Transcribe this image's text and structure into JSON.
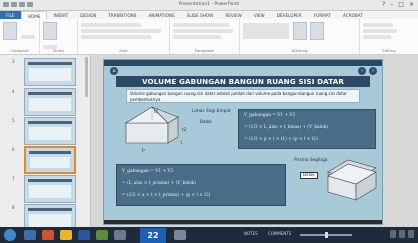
{
  "window": {
    "title": "Presentation1 - PowerPoint"
  },
  "ribbon": {
    "tabs": [
      "FILE",
      "HOME",
      "INSERT",
      "DESIGN",
      "TRANSITIONS",
      "ANIMATIONS",
      "SLIDE SHOW",
      "REVIEW",
      "VIEW",
      "DEVELOPER",
      "FORMAT",
      "ACROBAT"
    ],
    "groups": [
      "Clipboard",
      "Slides",
      "Font",
      "Paragraph",
      "Drawing",
      "Editing"
    ]
  },
  "slides_pane": {
    "numbers": [
      "3",
      "4",
      "5",
      "6",
      "7",
      "8"
    ]
  },
  "slide": {
    "title": "VOLUME GABUNGAN BANGUN RUANG SISI DATAR",
    "intro": "Volume gabungan bangun ruang sisi datar adalah jumlah dari volume pada bangun-bangun ruang sisi datar pembentuknya.",
    "shape1_name": "Limas Segi Empat",
    "shape1_sub": "Balok",
    "shape2_name": "Prisma Segitiga",
    "shape2_sub": "Balok",
    "formula1": {
      "lines": [
        "V_gabungan = V1 + V2",
        "= (1/3 × L_alas × t_limas) + (V_balok)",
        "= (1/3 × p × l × t1) + (p × l × t2)"
      ]
    },
    "formula2": {
      "lines": [
        "V_gabungan = V1 + V2",
        "= (L_alas × t_prisma) + (V_balok)",
        "= (1/2 × a × t × t_prisma) + (p × l × t2)"
      ]
    },
    "labels": {
      "t1": "t1",
      "t2": "t2",
      "l": "l",
      "p": "p"
    }
  },
  "statusbar": {
    "slide_number": "22",
    "notes": "NOTES",
    "comments": "COMMENTS"
  }
}
